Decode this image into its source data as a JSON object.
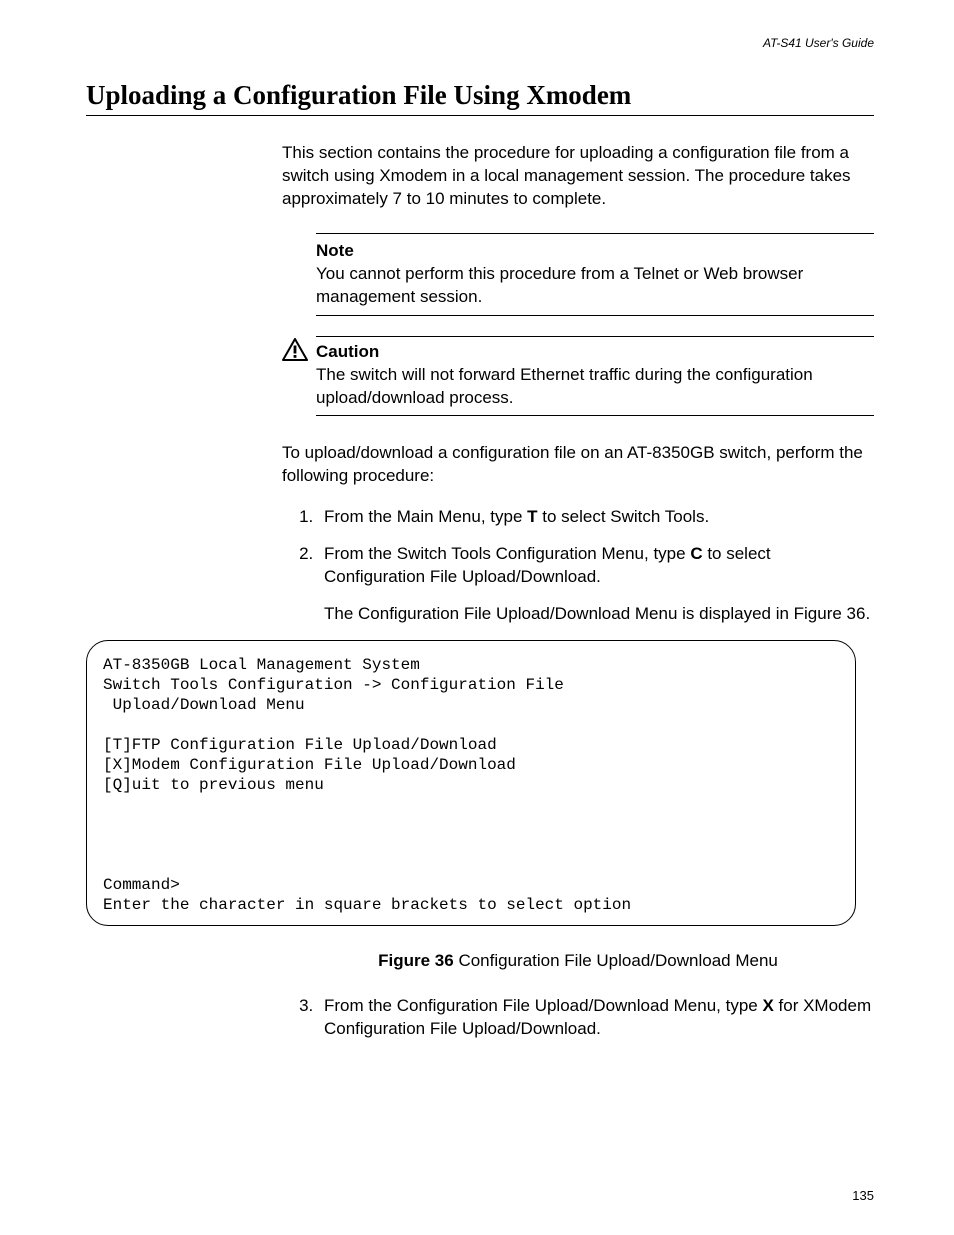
{
  "header": {
    "guide": "AT-S41 User's Guide"
  },
  "title": "Uploading a Configuration File Using Xmodem",
  "intro": "This section contains the procedure for uploading a configuration file from a switch using Xmodem in a local management session. The procedure takes approximately 7 to 10 minutes to complete.",
  "note": {
    "label": "Note",
    "text": "You cannot perform this procedure from a Telnet or Web browser management session."
  },
  "caution": {
    "label": "Caution",
    "text": "The switch will not forward Ethernet traffic during the configuration upload/download process."
  },
  "lead": "To upload/download a configuration file on an AT-8350GB switch, perform the following procedure:",
  "steps": {
    "s1_pre": "From the Main Menu, type ",
    "s1_key": "T",
    "s1_post": " to select Switch Tools.",
    "s2_pre": "From the Switch Tools Configuration Menu, type ",
    "s2_key": "C",
    "s2_post": " to select Configuration File Upload/Download.",
    "s2_sub": "The Configuration File Upload/Download Menu is displayed in Figure 36.",
    "s3_pre": "From the Configuration File Upload/Download Menu, type ",
    "s3_key": "X",
    "s3_post": " for XModem Configuration File Upload/Download."
  },
  "terminal": "AT-8350GB Local Management System\nSwitch Tools Configuration -> Configuration File\n Upload/Download Menu\n\n[T]FTP Configuration File Upload/Download\n[X]Modem Configuration File Upload/Download\n[Q]uit to previous menu\n\n\n\n\nCommand>\nEnter the character in square brackets to select option",
  "figure": {
    "label": "Figure 36",
    "caption": "  Configuration File Upload/Download Menu"
  },
  "page_number": "135"
}
